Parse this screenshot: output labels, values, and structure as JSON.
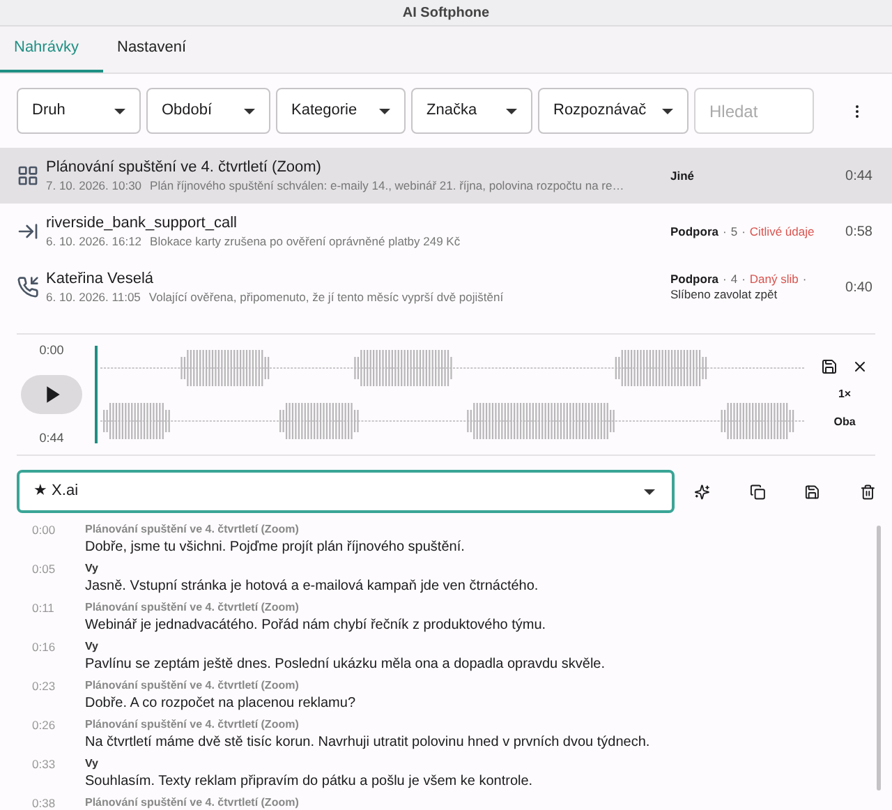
{
  "window": {
    "title": "AI Softphone"
  },
  "tabs": [
    {
      "label": "Nahrávky",
      "selected": true
    },
    {
      "label": "Nastavení",
      "selected": false
    }
  ],
  "filters": [
    "Druh",
    "Období",
    "Kategorie",
    "Značka",
    "Rozpoznávač"
  ],
  "search": {
    "placeholder": "Hledat"
  },
  "recordings": [
    {
      "kind": "meeting",
      "selected": true,
      "title": "Plánování spuštění ve 4. čtvrtletí (Zoom)",
      "date": "7. 10. 2026. 10:30",
      "summary": "Plán říjnového spuštění schválen: e-maily 14., webinář 21. října, polovina rozpočtu na re…",
      "tags": [
        {
          "kind": "category",
          "text": "Jiné"
        }
      ],
      "duration": "0:44"
    },
    {
      "kind": "incoming",
      "selected": false,
      "title": "riverside_bank_support_call",
      "date": "6. 10. 2026. 16:12",
      "summary": "Blokace karty zrušena po ověření oprávněné platby 249 Kč",
      "tags": [
        {
          "kind": "category",
          "text": "Podpora"
        },
        {
          "kind": "separator",
          "text": "·"
        },
        {
          "kind": "score",
          "text": "5"
        },
        {
          "kind": "separator",
          "text": "·"
        },
        {
          "kind": "flag",
          "text": "Citlivé údaje"
        }
      ],
      "duration": "0:58"
    },
    {
      "kind": "call-received",
      "selected": false,
      "title": "Kateřina Veselá",
      "date": "6. 10. 2026. 11:05",
      "summary": "Volající ověřena, připomenuto, že jí tento měsíc vyprší dvě pojištění",
      "tags": [
        {
          "kind": "category",
          "text": "Podpora"
        },
        {
          "kind": "separator",
          "text": "·"
        },
        {
          "kind": "score",
          "text": "4"
        },
        {
          "kind": "separator",
          "text": "·"
        },
        {
          "kind": "flag",
          "text": "Daný slib"
        },
        {
          "kind": "separator",
          "text": "·"
        }
      ],
      "note": "Slíbeno zavolat zpět",
      "duration": "0:40"
    }
  ],
  "player": {
    "start": "0:00",
    "end": "0:44",
    "speed": "1×",
    "channel": "Oba"
  },
  "recognizer": {
    "value": "★ X.ai"
  },
  "transcript": [
    {
      "time": "0:00",
      "kind": "other",
      "speaker": "Plánování spuštění ve 4. čtvrtletí (Zoom)",
      "text": "Dobře, jsme tu všichni. Pojďme projít plán říjnového spuštění."
    },
    {
      "time": "0:05",
      "kind": "me",
      "speaker": "Vy",
      "text": "Jasně. Vstupní stránka je hotová a e-mailová kampaň jde ven čtrnáctého."
    },
    {
      "time": "0:11",
      "kind": "other",
      "speaker": "Plánování spuštění ve 4. čtvrtletí (Zoom)",
      "text": "Webinář je jednadvacátého. Pořád nám chybí řečník z produktového týmu."
    },
    {
      "time": "0:16",
      "kind": "me",
      "speaker": "Vy",
      "text": "Pavlínu se zeptám ještě dnes. Poslední ukázku měla ona a dopadla opravdu skvěle."
    },
    {
      "time": "0:23",
      "kind": "other",
      "speaker": "Plánování spuštění ve 4. čtvrtletí (Zoom)",
      "text": "Dobře. A co rozpočet na placenou reklamu?"
    },
    {
      "time": "0:26",
      "kind": "other",
      "speaker": "Plánování spuštění ve 4. čtvrtletí (Zoom)",
      "text": "Na čtvrtletí máme dvě stě tisíc korun. Navrhuji utratit polovinu hned v prvních dvou týdnech."
    },
    {
      "time": "0:33",
      "kind": "me",
      "speaker": "Vy",
      "text": "Souhlasím. Texty reklam připravím do pátku a pošlu je všem ke kontrole."
    },
    {
      "time": "0:38",
      "kind": "other",
      "speaker": "Plánování spuštění ve 4. čtvrtletí (Zoom)"
    }
  ]
}
